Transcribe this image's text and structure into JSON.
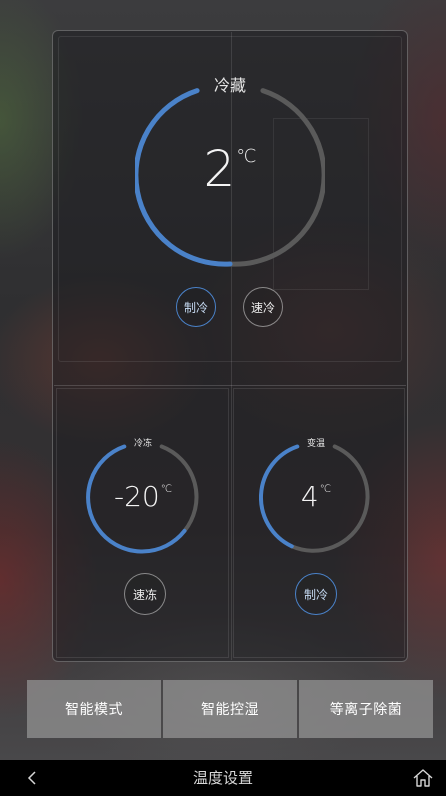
{
  "zones": {
    "refrigerator": {
      "label": "冷藏",
      "temperature": "2",
      "unit": "℃",
      "modes": [
        {
          "label": "制冷",
          "active": true
        },
        {
          "label": "速冷",
          "active": false
        }
      ]
    },
    "freezer": {
      "label": "冷冻",
      "temperature": "-20",
      "unit": "℃",
      "modes": [
        {
          "label": "速冻",
          "active": false
        }
      ]
    },
    "variable": {
      "label": "变温",
      "temperature": "4",
      "unit": "℃",
      "modes": [
        {
          "label": "制冷",
          "active": true
        }
      ]
    }
  },
  "functions": [
    {
      "label": "智能模式"
    },
    {
      "label": "智能控湿"
    },
    {
      "label": "等离子除菌"
    }
  ],
  "nav": {
    "title": "温度设置",
    "back_icon": "chevron-left-icon",
    "home_icon": "home-icon"
  },
  "colors": {
    "accent": "#4a82c9",
    "ring_track": "#5a5a5a",
    "nav_background": "#000000",
    "function_button": "#969696"
  }
}
